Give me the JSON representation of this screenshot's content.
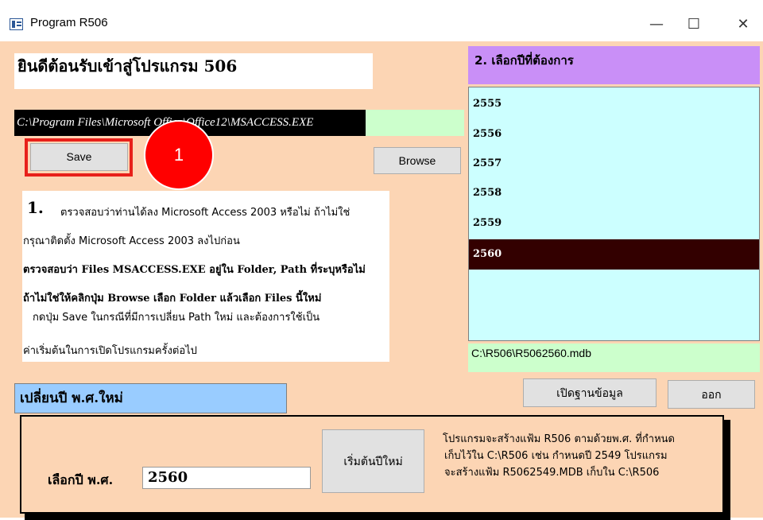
{
  "window": {
    "title": "Program R506",
    "minimize": "—",
    "maximize": "☐",
    "close": "✕"
  },
  "welcome": "ยินดีต้อนรับเข้าสู่โปรแกรม 506",
  "exe_path": "C:\\Program Files\\Microsoft Office\\Office12\\MSACCESS.EXE",
  "buttons": {
    "save": "Save",
    "browse": "Browse",
    "open_db": "เปิดฐานข้อมูล",
    "exit": "ออก",
    "start_new_year": "เริ่มต้นปีใหม่"
  },
  "badge": "1",
  "instructions": {
    "number": "1.",
    "line1": "ตรวจสอบว่าท่านได้ลง Microsoft Access 2003 หรือไม่ ถ้าไม่ใช่",
    "line2": "กรุณาติดตั้ง Microsoft Access 2003 ลงไปก่อน",
    "line3": "ตรวจสอบว่า Files  MSACCESS.EXE อยู่ใน Folder, Path ที่ระบุหรือไม่",
    "line4": "ถ้าไม่ใช่ให้คลิกปุ่ม  Browse เลือก Folder แล้วเลือก Files นี้ใหม่",
    "line5": "กดปุ่ม Save ในกรณีที่มีการเปลี่ยน Path ใหม่ และต้องการใช้เป็น",
    "line6": "ค่าเริ่มต้นในการเปิดโปรแกรมครั้งต่อไป"
  },
  "year_select": {
    "header": "2. เลือกปีที่ต้องการ",
    "years": [
      "2555",
      "2556",
      "2557",
      "2558",
      "2559",
      "2560"
    ],
    "selected": "2560"
  },
  "db_path": "C:\\R506\\R5062560.mdb",
  "change_year": {
    "title": "เปลี่ยนปี พ.ศ.ใหม่",
    "label": "เลือกปี พ.ศ.",
    "value": "2560",
    "note1": "โปรแกรมจะสร้างแฟ้ม R506 ตามด้วยพ.ศ. ที่กำหนด",
    "note2": "เก็บไว้ใน C:\\R506 เช่น กำหนดปี 2549 โปรแกรม",
    "note3": "จะสร้างแฟ้ม R5062549.MDB  เก็บใน C:\\R506"
  }
}
